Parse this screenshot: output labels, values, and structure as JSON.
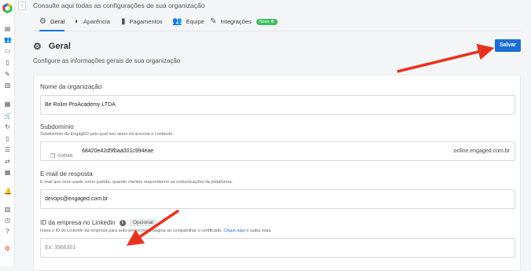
{
  "header": {
    "title": "Consulte aqui todas as configurações de sua organização",
    "collapse_glyph": "‹"
  },
  "tabs": [
    {
      "label": "Geral",
      "icon": "gear-icon"
    },
    {
      "label": "Aparência",
      "icon": "palette-icon"
    },
    {
      "label": "Pagamentos",
      "icon": "document-icon"
    },
    {
      "label": "Equipe",
      "icon": "team-icon"
    },
    {
      "label": "Integrações",
      "icon": "plug-icon",
      "badge": "Novo ✚"
    }
  ],
  "section": {
    "title": "Geral",
    "description": "Configure as informações gerais de sua organização",
    "save_label": "Salvar"
  },
  "form": {
    "org_name": {
      "label": "Nome da organização",
      "value": "Be Rolim ProAcademy LTDA"
    },
    "subdomain": {
      "label": "Subdomínio",
      "help": "Subdomínio da EngagED pelo qual seu aluno irá acessar o conteúdo.",
      "copy_label": "COPIAR",
      "value": "68420e42d5fbaa001c994eae",
      "suffix": ".online.engaged.com.br"
    },
    "reply_email": {
      "label": "E-mail de resposta",
      "help": "E-mail que será usado como padrão, quando clientes responderem as comunicações da plataforma.",
      "value": "devops@engaged.com.br"
    },
    "linkedin": {
      "label": "ID da empresa no Linkedin",
      "optional_label": "Opcional",
      "help_prefix": "Insira o ID do LinkedIn da empresa para auto-preencher a página ao compartilhar o certificado.",
      "help_link": "Clique aqui",
      "help_suffix": "e saiba mais.",
      "placeholder": "Ex: 3966301"
    }
  },
  "sidebar": {
    "icons": [
      "book-icon",
      "users-icon",
      "monitor-icon",
      "file-icon",
      "tools-icon",
      "chart-icon",
      "calendar-icon",
      "cart-icon",
      "refresh-icon",
      "document-icon",
      "contacts-icon",
      "transfer-icon",
      "grid-icon",
      "bell-icon",
      "library-icon",
      "history-icon",
      "help-icon",
      "settings-icon"
    ],
    "glyphs": [
      "▤",
      "👥",
      "▭",
      "▯",
      "✎",
      "▥",
      "▦",
      "🛒",
      "↻",
      "▯",
      "☰",
      "⇄",
      "▦",
      "🔔",
      "▥",
      "◷",
      "?",
      "⚙"
    ]
  },
  "colors": {
    "accent": "#1a6fd6",
    "arrow": "#e8321e",
    "new_badge": "#3dbf62",
    "settings_active": "#e8321e"
  }
}
